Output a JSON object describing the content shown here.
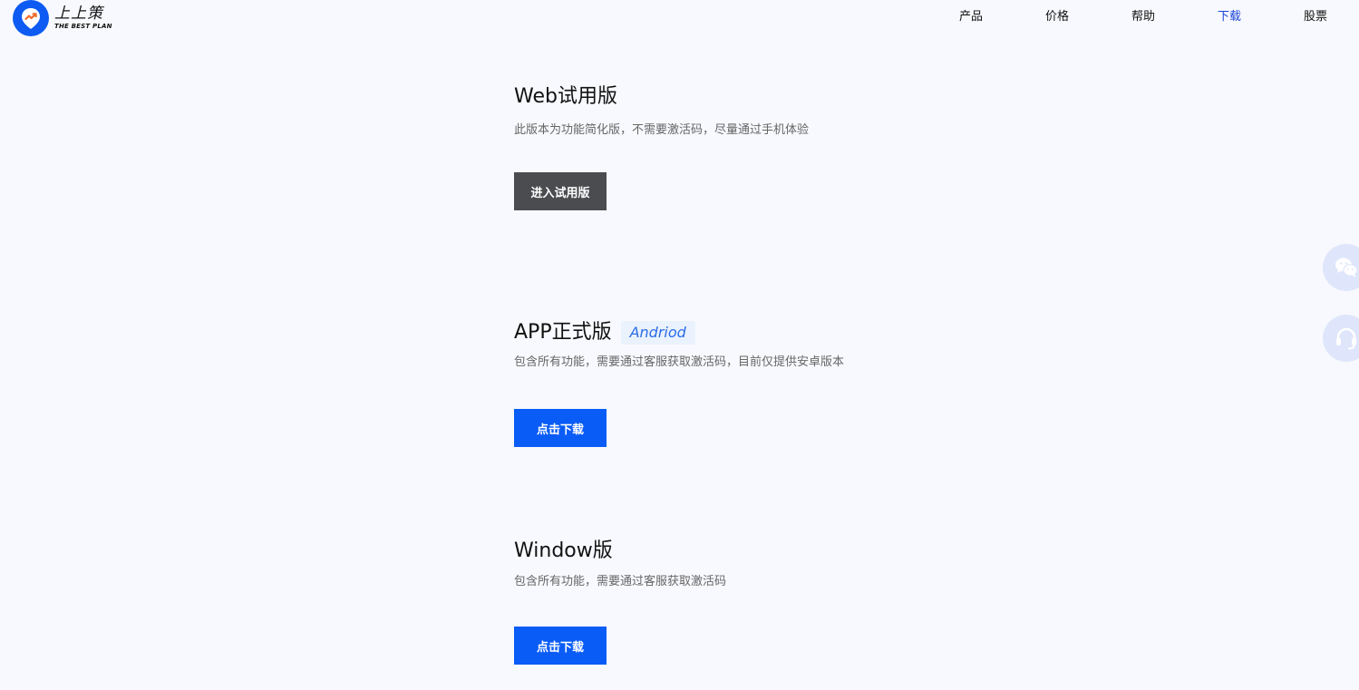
{
  "brand": {
    "name_cn": "上上策",
    "name_en": "THE BEST PLAN",
    "logo_icon": "trend-arrow-icon"
  },
  "nav": {
    "items": [
      {
        "label": "产品",
        "active": false
      },
      {
        "label": "价格",
        "active": false
      },
      {
        "label": "帮助",
        "active": false
      },
      {
        "label": "下载",
        "active": true
      },
      {
        "label": "股票",
        "active": false
      }
    ]
  },
  "sections": [
    {
      "title": "Web试用版",
      "badge": "",
      "description": "此版本为功能简化版，不需要激活码，尽量通过手机体验",
      "button_label": "进入试用版"
    },
    {
      "title": "APP正式版",
      "badge": "Andriod",
      "description": "包含所有功能，需要通过客服获取激活码，目前仅提供安卓版本",
      "button_label": "点击下载"
    },
    {
      "title": "Window版",
      "badge": "",
      "description": "包含所有功能，需要通过客服获取激活码",
      "button_label": "点击下载"
    }
  ],
  "floating": {
    "wechat_icon": "wechat-icon",
    "support_icon": "headset-icon"
  },
  "colors": {
    "background": "#f8f9fe",
    "brand_blue": "#0d5bf2",
    "nav_active": "#1a44d8",
    "button_dark": "#4b4c50",
    "button_blue": "#0a5cf6",
    "badge_bg": "#eaf2fd",
    "badge_text": "#2a6ee8",
    "float_bg": "#dfe6fb"
  }
}
